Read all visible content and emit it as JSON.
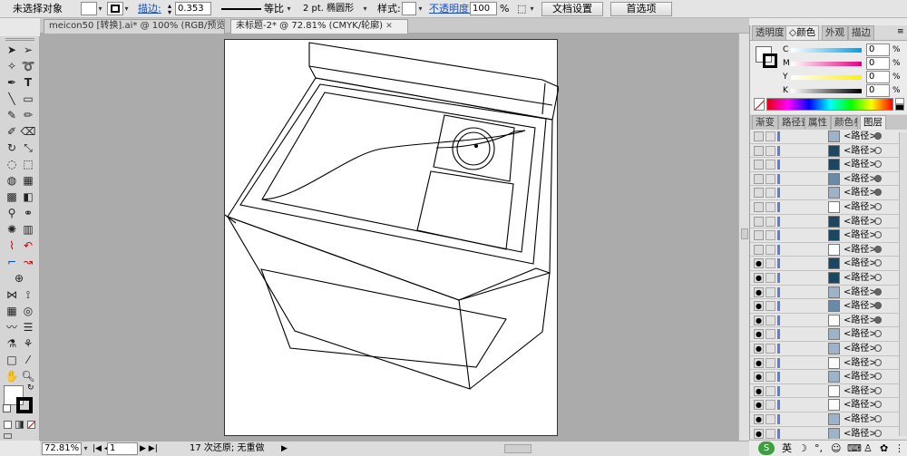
{
  "control_bar": {
    "selection_status": "未选择对象",
    "stroke_label": "描边:",
    "stroke_weight": "0.353",
    "stroke_profile": "等比",
    "brush": "2 pt. 椭圆形",
    "style_label": "样式:",
    "opacity_label": "不透明度:",
    "opacity_value": "100",
    "opacity_unit": "%",
    "document_setup_button": "文档设置",
    "preferences_button": "首选项"
  },
  "tabs": [
    {
      "label": "meicon50 [转换].ai* @ 100% (RGB/预览)"
    },
    {
      "label": "未标题-2* @ 72.81% (CMYK/轮廓)"
    }
  ],
  "status_bar": {
    "zoom": "72.81%",
    "page": "1",
    "status_text": "17 次还原; 无重做"
  },
  "color_panel": {
    "tabs": [
      "透明度",
      "颜色",
      "外观",
      "描边"
    ],
    "active_tab": "颜色",
    "channels": [
      {
        "label": "C",
        "value": "0",
        "unit": "%",
        "color": "#00a0e9"
      },
      {
        "label": "M",
        "value": "0",
        "unit": "%",
        "color": "#e4007f"
      },
      {
        "label": "Y",
        "value": "0",
        "unit": "%",
        "color": "#fff100"
      },
      {
        "label": "K",
        "value": "0",
        "unit": "%",
        "color": "#000000"
      }
    ]
  },
  "layers_panel": {
    "tabs": [
      "渐变",
      "路径查",
      "属性",
      "颜色参",
      "图层"
    ],
    "active_tab": "图层",
    "rows": [
      {
        "name": "<路径>",
        "visible": false,
        "thumb": "light",
        "filled": true
      },
      {
        "name": "<路径>",
        "visible": false,
        "thumb": "dark",
        "filled": false
      },
      {
        "name": "<路径>",
        "visible": false,
        "thumb": "dark",
        "filled": false
      },
      {
        "name": "<路径>",
        "visible": false,
        "thumb": "mid",
        "filled": true
      },
      {
        "name": "<路径>",
        "visible": false,
        "thumb": "light",
        "filled": true
      },
      {
        "name": "<路径>",
        "visible": false,
        "thumb": "white",
        "filled": false
      },
      {
        "name": "<路径>",
        "visible": false,
        "thumb": "dark",
        "filled": false
      },
      {
        "name": "<路径>",
        "visible": false,
        "thumb": "dark",
        "filled": false
      },
      {
        "name": "<路径>",
        "visible": false,
        "thumb": "white",
        "filled": true
      },
      {
        "name": "<路径>",
        "visible": true,
        "thumb": "dark",
        "filled": false
      },
      {
        "name": "<路径>",
        "visible": true,
        "thumb": "dark",
        "filled": false
      },
      {
        "name": "<路径>",
        "visible": true,
        "thumb": "light",
        "filled": true
      },
      {
        "name": "<路径>",
        "visible": true,
        "thumb": "mid",
        "filled": true
      },
      {
        "name": "<路径>",
        "visible": true,
        "thumb": "white",
        "filled": true
      },
      {
        "name": "<路径>",
        "visible": true,
        "thumb": "light",
        "filled": false
      },
      {
        "name": "<路径>",
        "visible": true,
        "thumb": "light",
        "filled": false
      },
      {
        "name": "<路径>",
        "visible": true,
        "thumb": "white",
        "filled": false
      },
      {
        "name": "<路径>",
        "visible": true,
        "thumb": "light",
        "filled": false
      },
      {
        "name": "<路径>",
        "visible": true,
        "thumb": "white",
        "filled": false
      },
      {
        "name": "<路径>",
        "visible": true,
        "thumb": "white",
        "filled": false
      },
      {
        "name": "<路径>",
        "visible": true,
        "thumb": "light",
        "filled": false
      },
      {
        "name": "<路径>",
        "visible": true,
        "thumb": "light",
        "filled": false
      },
      {
        "name": "<路径>",
        "visible": true,
        "thumb": "dark",
        "filled": false
      },
      {
        "name": "<路径>",
        "visible": true,
        "thumb": "white",
        "filled": false
      }
    ]
  },
  "ime": {
    "lang": "英"
  }
}
